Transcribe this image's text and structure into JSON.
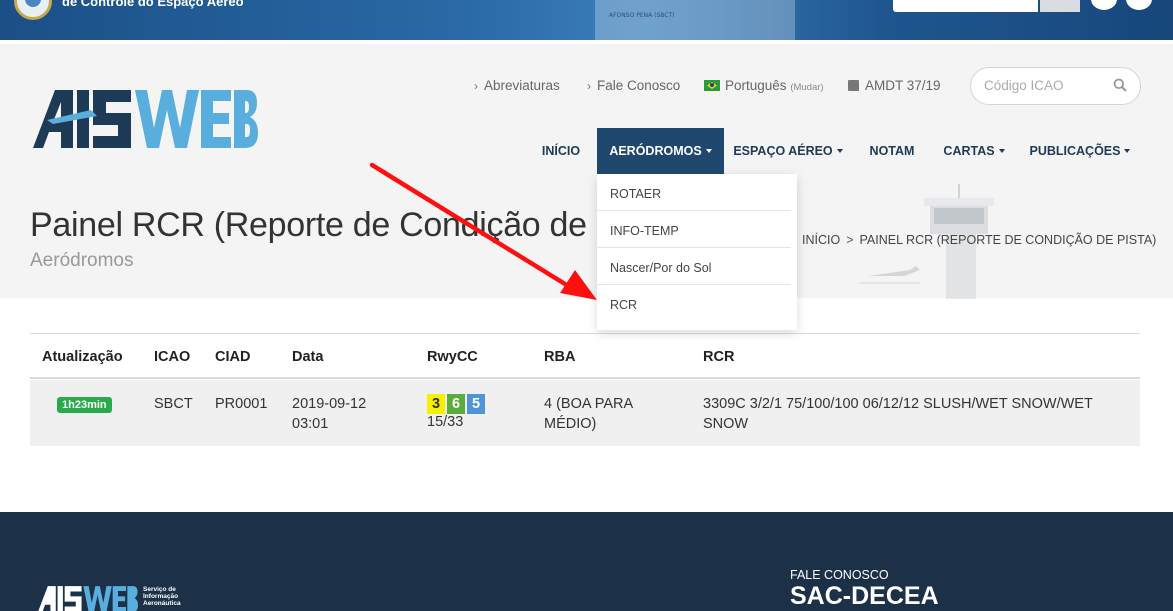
{
  "topbar": {
    "org_name": "de Controle do Espaço Aéreo",
    "paper_text": "AFONSO PENA (SBCT)"
  },
  "header": {
    "links": {
      "abreviaturas": "Abreviaturas",
      "fale_conosco": "Fale Conosco",
      "language": "Português",
      "language_change": "(Mudar)",
      "amdt": "AMDT 37/19"
    },
    "search": {
      "placeholder": "Código ICAO"
    },
    "nav": {
      "inicio": "INÍCIO",
      "aerodromos": "AERÓDROMOS",
      "espaco_aereo": "ESPAÇO AÉREO",
      "notam": "NOTAM",
      "cartas": "CARTAS",
      "publicacoes": "PUBLICAÇÕES"
    },
    "title": "Painel RCR (Reporte de Condição de Pista)",
    "subtitle": "Aeródromos",
    "breadcrumb": {
      "home": "INÍCIO",
      "separator": ">",
      "current": "PAINEL RCR (REPORTE DE CONDIÇÃO DE PISTA)"
    }
  },
  "dropdown": {
    "items": [
      "ROTAER",
      "INFO-TEMP",
      "Nascer/Por do Sol",
      "RCR"
    ]
  },
  "table": {
    "headers": [
      "Atualização",
      "ICAO",
      "CIAD",
      "Data",
      "RwyCC",
      "RBA",
      "RCR"
    ],
    "rows": [
      {
        "update": "1h23min",
        "icao": "SBCT",
        "ciad": "PR0001",
        "date": "2019-09-12",
        "time": "03:01",
        "rwycc": [
          {
            "value": "3",
            "color": "#f5f000"
          },
          {
            "value": "6",
            "color": "#5aac3b"
          },
          {
            "value": "5",
            "color": "#4f95d4"
          }
        ],
        "runway": "15/33",
        "rba_line1": "4 (BOA PARA",
        "rba_line2": "MÉDIO)",
        "rcr_line1": "3309C 3/2/1 75/100/100 06/12/12 SLUSH/WET SNOW/WET",
        "rcr_line2": "SNOW"
      }
    ]
  },
  "footer": {
    "service_line1": "Serviço de",
    "service_line2": "Informação",
    "service_line3": "Aeronáutica",
    "contact_label": "FALE CONOSCO",
    "contact_value": "SAC-DECEA"
  },
  "colors": {
    "nav_active": "#20486f",
    "badge_green": "#2aab4b",
    "footer_bg": "#1c3147",
    "logo_dark": "#1d3a57",
    "logo_light": "#5aaede",
    "annotation_red": "#ff1010"
  }
}
